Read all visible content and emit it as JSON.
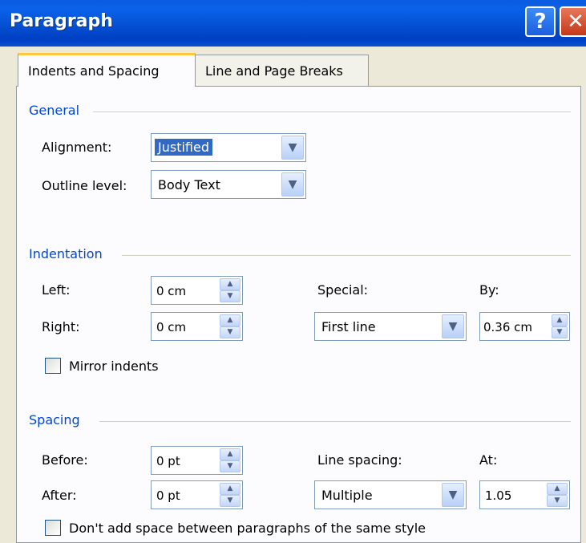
{
  "window": {
    "title": "Paragraph",
    "help_glyph": "?",
    "close_glyph": "✕"
  },
  "tabs": [
    {
      "label": "Indents and Spacing",
      "active": true
    },
    {
      "label": "Line and Page Breaks",
      "active": false
    }
  ],
  "general": {
    "heading": "General",
    "alignment_label": "Alignment:",
    "alignment_value": "Justified",
    "outline_label": "Outline level:",
    "outline_value": "Body Text"
  },
  "indentation": {
    "heading": "Indentation",
    "left_label": "Left:",
    "left_value": "0 cm",
    "right_label": "Right:",
    "right_value": "0 cm",
    "special_label": "Special:",
    "special_value": "First line",
    "by_label": "By:",
    "by_value": "0.36 cm",
    "mirror_label": "Mirror indents",
    "mirror_checked": false
  },
  "spacing": {
    "heading": "Spacing",
    "before_label": "Before:",
    "before_value": "0 pt",
    "after_label": "After:",
    "after_value": "0 pt",
    "line_spacing_label": "Line spacing:",
    "line_spacing_value": "Multiple",
    "at_label": "At:",
    "at_value": "1.05",
    "dont_add_label": "Don't add space between paragraphs of the same style",
    "dont_add_checked": false
  },
  "icons": {
    "dropdown": "chevron-down-icon",
    "spin_up": "caret-up-icon",
    "spin_down": "caret-down-icon"
  },
  "colors": {
    "title_bar": "#0450d2",
    "section_heading": "#0046d5",
    "selection": "#316ac5",
    "tab_highlight": "#ffc83c"
  }
}
